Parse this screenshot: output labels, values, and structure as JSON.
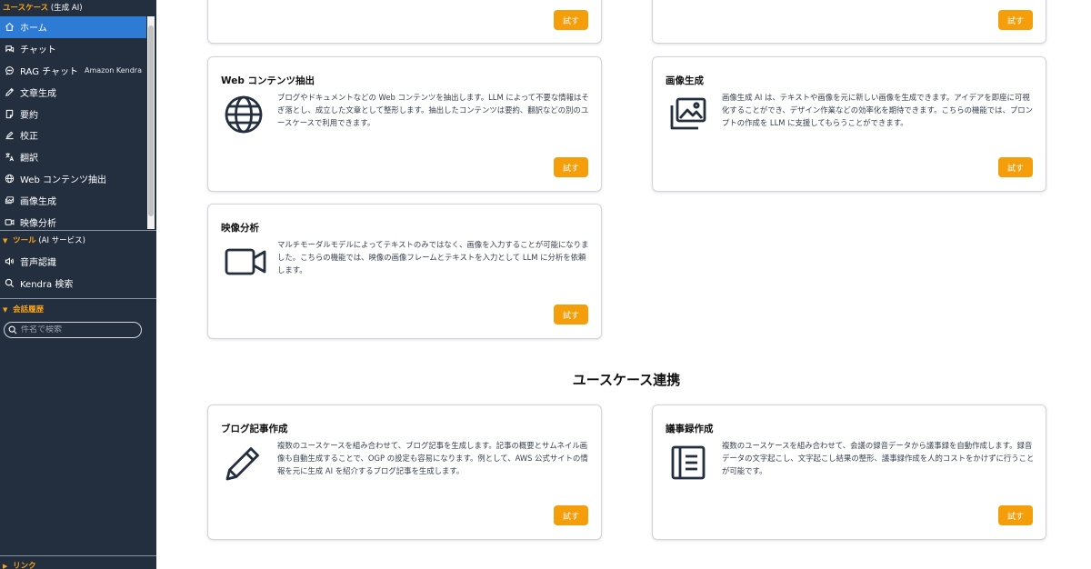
{
  "sidebar": {
    "usecase_header": {
      "main": "ユースケース",
      "sub": "(生成 AI)"
    },
    "items": [
      {
        "label": "ホーム",
        "icon": "home-icon"
      },
      {
        "label": "チャット",
        "icon": "chat-icon"
      },
      {
        "label": "RAG チャット",
        "icon": "rag-chat-icon",
        "sub": "Amazon Kendra"
      },
      {
        "label": "文章生成",
        "icon": "pencil-icon"
      },
      {
        "label": "要約",
        "icon": "note-icon"
      },
      {
        "label": "校正",
        "icon": "edit-icon"
      },
      {
        "label": "翻訳",
        "icon": "translate-icon"
      },
      {
        "label": "Web コンテンツ抽出",
        "icon": "globe-icon"
      },
      {
        "label": "画像生成",
        "icon": "image-icon"
      },
      {
        "label": "映像分析",
        "icon": "video-icon"
      }
    ],
    "tools_header": {
      "main": "ツール",
      "sub": "(AI サービス)"
    },
    "tools": [
      {
        "label": "音声認識",
        "icon": "speaker-icon"
      },
      {
        "label": "Kendra 検索",
        "icon": "search-icon"
      }
    ],
    "history_header": "会話履歴",
    "search_placeholder": "件名で検索",
    "link_header": "リンク"
  },
  "cards_top": [
    {
      "button": "試す"
    },
    {
      "button": "試す"
    }
  ],
  "cards": [
    {
      "title": "Web コンテンツ抽出",
      "icon": "globe-icon",
      "desc": "ブログやドキュメントなどの Web コンテンツを抽出します。LLM によって不要な情報はそぎ落とし、成立した文章として整形します。抽出したコンテンツは要約、翻訳などの別のユースケースで利用できます。",
      "button": "試す"
    },
    {
      "title": "画像生成",
      "icon": "images-icon",
      "desc": "画像生成 AI は、テキストや画像を元に新しい画像を生成できます。アイデアを即座に可視化することができ、デザイン作業などの効率化を期待できます。こちらの機能では、プロンプトの作成を LLM に支援してもらうことができます。",
      "button": "試す"
    },
    {
      "title": "映像分析",
      "icon": "video-camera-icon",
      "desc": "マルチモーダルモデルによってテキストのみではなく、画像を入力することが可能になりました。こちらの機能では、映像の画像フレームとテキストを入力として LLM に分析を依頼します。",
      "button": "試す"
    }
  ],
  "integration_title": "ユースケース連携",
  "integration_cards": [
    {
      "title": "ブログ記事作成",
      "icon": "pen-icon",
      "desc": "複数のユースケースを組み合わせて、ブログ記事を生成します。記事の概要とサムネイル画像も自動生成することで、OGP の設定も容易になります。例として、AWS 公式サイトの情報を元に生成 AI を紹介するブログ記事を生成します。",
      "button": "試す"
    },
    {
      "title": "議事録作成",
      "icon": "document-list-icon",
      "desc": "複数のユースケースを組み合わせて、会議の録音データから議事録を自動作成します。録音データの文字起こし、文字起こし結果の整形、議事録作成を人的コストをかけずに行うことが可能です。",
      "button": "試す"
    }
  ]
}
